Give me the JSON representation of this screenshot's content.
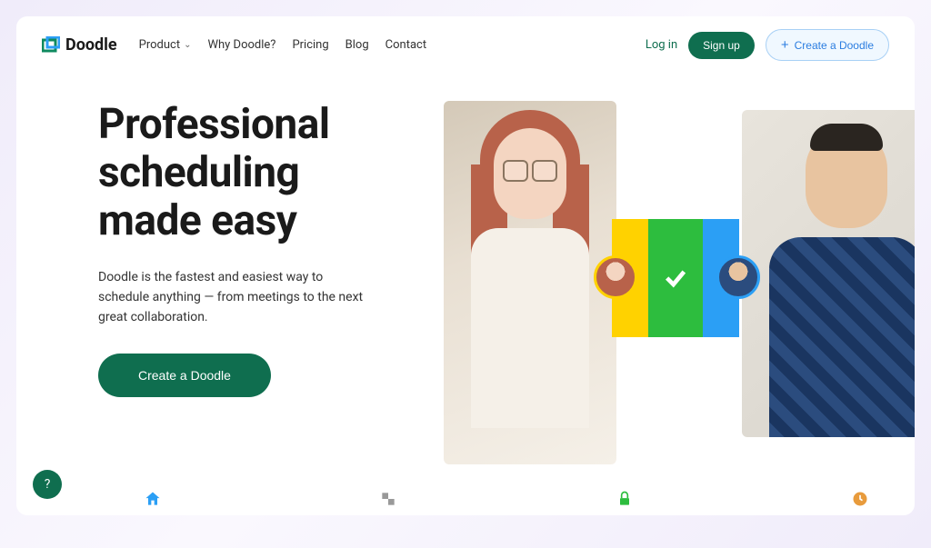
{
  "brand": {
    "name": "Doodle"
  },
  "nav": {
    "items": [
      {
        "label": "Product",
        "hasDropdown": true
      },
      {
        "label": "Why Doodle?",
        "hasDropdown": false
      },
      {
        "label": "Pricing",
        "hasDropdown": false
      },
      {
        "label": "Blog",
        "hasDropdown": false
      },
      {
        "label": "Contact",
        "hasDropdown": false
      }
    ]
  },
  "header_actions": {
    "login": "Log in",
    "signup": "Sign up",
    "create": "Create a Doodle"
  },
  "hero": {
    "title": "Professional scheduling made easy",
    "subtitle": "Doodle is the fastest and easiest way to schedule anything — from meetings to the next great collaboration.",
    "cta": "Create a Doodle"
  },
  "help": {
    "label": "?"
  },
  "colors": {
    "primary_green": "#0f6e4f",
    "accent_blue": "#2b7de0",
    "bar_yellow": "#ffd200",
    "bar_green": "#2dbd3e",
    "bar_blue": "#2b9ff5"
  }
}
